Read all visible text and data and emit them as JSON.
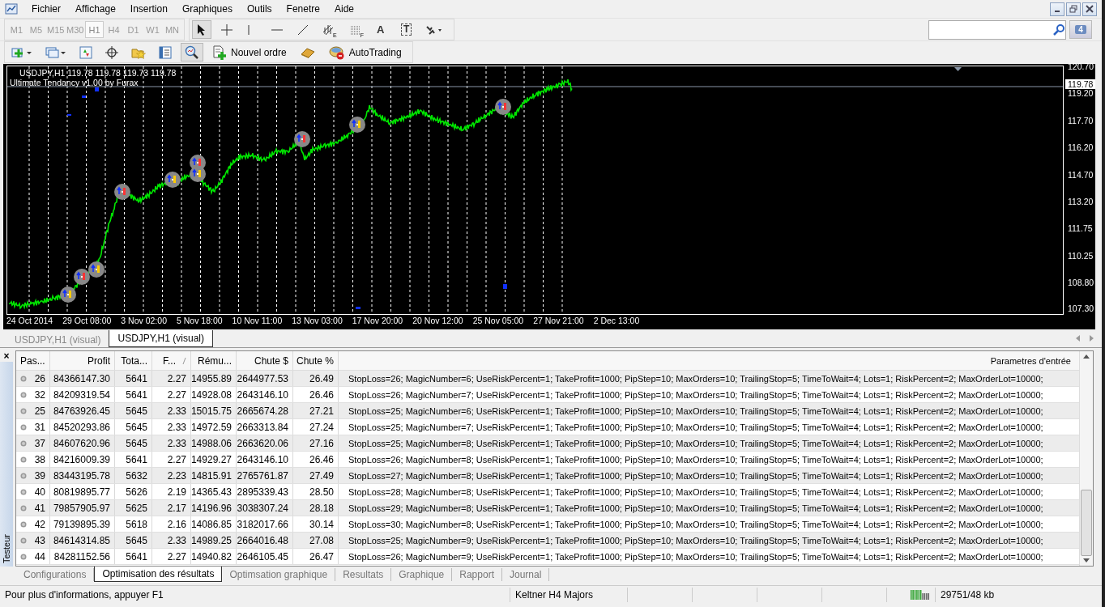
{
  "menu": [
    "Fichier",
    "Affichage",
    "Insertion",
    "Graphiques",
    "Outils",
    "Fenetre",
    "Aide"
  ],
  "timeframes": [
    {
      "label": "M1",
      "selected": false
    },
    {
      "label": "M5",
      "selected": false
    },
    {
      "label": "M15",
      "selected": false
    },
    {
      "label": "M30",
      "selected": false
    },
    {
      "label": "H1",
      "selected": true
    },
    {
      "label": "H4",
      "selected": false
    },
    {
      "label": "D1",
      "selected": false
    },
    {
      "label": "W1",
      "selected": false
    },
    {
      "label": "MN",
      "selected": false
    }
  ],
  "tools": [
    {
      "kind": "cursor",
      "selected": true
    },
    {
      "kind": "crosshair",
      "selected": false
    },
    {
      "kind": "vline",
      "selected": false
    },
    {
      "kind": "hline",
      "selected": false
    },
    {
      "kind": "trend",
      "selected": false
    },
    {
      "kind": "channel",
      "text": "E",
      "selected": false
    },
    {
      "kind": "fibo",
      "text": "F",
      "selected": false
    },
    {
      "kind": "letter",
      "text": "A",
      "selected": false
    },
    {
      "kind": "label",
      "text": "T",
      "selected": false
    },
    {
      "kind": "arrows",
      "selected": false
    }
  ],
  "toolbar2": [
    {
      "kind": "new-chart"
    },
    {
      "kind": "profiles"
    },
    {
      "kind": "market-watch"
    },
    {
      "kind": "data-window"
    },
    {
      "kind": "navigator"
    },
    {
      "kind": "terminal"
    },
    {
      "kind": "tester",
      "selected": true
    },
    {
      "kind": "order",
      "text": "Nouvel ordre"
    },
    {
      "kind": "gold"
    },
    {
      "kind": "auto",
      "text": "AutoTrading"
    }
  ],
  "chat_badge": "4",
  "chart": {
    "header": "USDJPY,H1  119.78 119.78 119.73 119.78",
    "indicator": "Ultimate Tendancy v1.00 by Furax",
    "current_price": "119.78",
    "y_labels": [
      "120.70",
      "119.20",
      "117.70",
      "116.20",
      "114.70",
      "113.20",
      "111.75",
      "110.25",
      "108.80",
      "107.30"
    ],
    "x_labels": [
      "24 Oct 2014",
      "29 Oct 08:00",
      "3 Nov 02:00",
      "5 Nov 18:00",
      "10 Nov 11:00",
      "13 Nov 03:00",
      "17 Nov 20:00",
      "20 Nov 12:00",
      "25 Nov 05:00",
      "27 Nov 21:00",
      "2 Dec 13:00"
    ]
  },
  "chart_tabs": [
    {
      "label": "USDJPY,H1 (visual)",
      "selected": false
    },
    {
      "label": "USDJPY,H1 (visual)",
      "selected": true
    }
  ],
  "panel": {
    "close": "×",
    "title": "Testeur"
  },
  "table": {
    "columns": [
      "Pas...",
      "Profit",
      "Tota...",
      "F...",
      "Rému...",
      "Chute $",
      "Chute %",
      "Parametres d'entrée"
    ],
    "rows": [
      [
        "26",
        "84366147.30",
        "5641",
        "2.27",
        "14955.89",
        "2644977.53",
        "26.49",
        "StopLoss=26; MagicNumber=6; UseRiskPercent=1; TakeProfit=1000; PipStep=10; MaxOrders=10; TrailingStop=5; TimeToWait=4; Lots=1; RiskPercent=2; MaxOrderLot=10000;"
      ],
      [
        "32",
        "84209319.54",
        "5641",
        "2.27",
        "14928.08",
        "2643146.10",
        "26.46",
        "StopLoss=26; MagicNumber=7; UseRiskPercent=1; TakeProfit=1000; PipStep=10; MaxOrders=10; TrailingStop=5; TimeToWait=4; Lots=1; RiskPercent=2; MaxOrderLot=10000;"
      ],
      [
        "25",
        "84763926.45",
        "5645",
        "2.33",
        "15015.75",
        "2665674.28",
        "27.21",
        "StopLoss=25; MagicNumber=6; UseRiskPercent=1; TakeProfit=1000; PipStep=10; MaxOrders=10; TrailingStop=5; TimeToWait=4; Lots=1; RiskPercent=2; MaxOrderLot=10000;"
      ],
      [
        "31",
        "84520293.86",
        "5645",
        "2.33",
        "14972.59",
        "2663313.84",
        "27.24",
        "StopLoss=25; MagicNumber=7; UseRiskPercent=1; TakeProfit=1000; PipStep=10; MaxOrders=10; TrailingStop=5; TimeToWait=4; Lots=1; RiskPercent=2; MaxOrderLot=10000;"
      ],
      [
        "37",
        "84607620.96",
        "5645",
        "2.33",
        "14988.06",
        "2663620.06",
        "27.16",
        "StopLoss=25; MagicNumber=8; UseRiskPercent=1; TakeProfit=1000; PipStep=10; MaxOrders=10; TrailingStop=5; TimeToWait=4; Lots=1; RiskPercent=2; MaxOrderLot=10000;"
      ],
      [
        "38",
        "84216009.39",
        "5641",
        "2.27",
        "14929.27",
        "2643146.10",
        "26.46",
        "StopLoss=26; MagicNumber=8; UseRiskPercent=1; TakeProfit=1000; PipStep=10; MaxOrders=10; TrailingStop=5; TimeToWait=4; Lots=1; RiskPercent=2; MaxOrderLot=10000;"
      ],
      [
        "39",
        "83443195.78",
        "5632",
        "2.23",
        "14815.91",
        "2765761.87",
        "27.49",
        "StopLoss=27; MagicNumber=8; UseRiskPercent=1; TakeProfit=1000; PipStep=10; MaxOrders=10; TrailingStop=5; TimeToWait=4; Lots=1; RiskPercent=2; MaxOrderLot=10000;"
      ],
      [
        "40",
        "80819895.77",
        "5626",
        "2.19",
        "14365.43",
        "2895339.43",
        "28.50",
        "StopLoss=28; MagicNumber=8; UseRiskPercent=1; TakeProfit=1000; PipStep=10; MaxOrders=10; TrailingStop=5; TimeToWait=4; Lots=1; RiskPercent=2; MaxOrderLot=10000;"
      ],
      [
        "41",
        "79857905.97",
        "5625",
        "2.17",
        "14196.96",
        "3038307.24",
        "28.18",
        "StopLoss=29; MagicNumber=8; UseRiskPercent=1; TakeProfit=1000; PipStep=10; MaxOrders=10; TrailingStop=5; TimeToWait=4; Lots=1; RiskPercent=2; MaxOrderLot=10000;"
      ],
      [
        "42",
        "79139895.39",
        "5618",
        "2.16",
        "14086.85",
        "3182017.66",
        "30.14",
        "StopLoss=30; MagicNumber=8; UseRiskPercent=1; TakeProfit=1000; PipStep=10; MaxOrders=10; TrailingStop=5; TimeToWait=4; Lots=1; RiskPercent=2; MaxOrderLot=10000;"
      ],
      [
        "43",
        "84614314.85",
        "5645",
        "2.33",
        "14989.25",
        "2664016.48",
        "27.08",
        "StopLoss=25; MagicNumber=9; UseRiskPercent=1; TakeProfit=1000; PipStep=10; MaxOrders=10; TrailingStop=5; TimeToWait=4; Lots=1; RiskPercent=2; MaxOrderLot=10000;"
      ],
      [
        "44",
        "84281152.56",
        "5641",
        "2.27",
        "14940.82",
        "2646105.45",
        "26.47",
        "StopLoss=26; MagicNumber=9; UseRiskPercent=1; TakeProfit=1000; PipStep=10; MaxOrders=10; TrailingStop=5; TimeToWait=4; Lots=1; RiskPercent=2; MaxOrderLot=10000;"
      ]
    ]
  },
  "bottom_tabs": [
    {
      "label": "Configurations",
      "selected": false
    },
    {
      "label": "Optimisation des résultats",
      "selected": true
    },
    {
      "label": "Optimsation graphique",
      "selected": false
    },
    {
      "label": "Resultats",
      "selected": false
    },
    {
      "label": "Graphique",
      "selected": false
    },
    {
      "label": "Rapport",
      "selected": false
    },
    {
      "label": "Journal",
      "selected": false
    }
  ],
  "status_bar": {
    "help": "Pour plus d'informations, appuyer F1",
    "profile": "Keltner H4 Majors",
    "traffic": "29751/48 kb"
  }
}
